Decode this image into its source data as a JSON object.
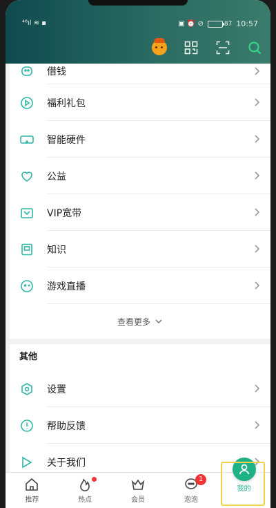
{
  "status_bar": {
    "signal": "⁴⁶ıl ≋ ▪",
    "icons": "▣ ⏰ ⊘",
    "battery": "87",
    "time": "10:57"
  },
  "menu": [
    {
      "label": "借钱",
      "icon": "piggy-bank-icon"
    },
    {
      "label": "福利礼包",
      "icon": "gift-play-icon"
    },
    {
      "label": "智能硬件",
      "icon": "vr-glasses-icon"
    },
    {
      "label": "公益",
      "icon": "heart-icon"
    },
    {
      "label": "VIP宽带",
      "icon": "broadband-icon"
    },
    {
      "label": "知识",
      "icon": "book-icon"
    },
    {
      "label": "游戏直播",
      "icon": "game-live-icon"
    }
  ],
  "see_more": "查看更多",
  "other": {
    "title": "其他",
    "items": [
      {
        "label": "设置",
        "icon": "settings-icon"
      },
      {
        "label": "帮助反馈",
        "icon": "help-icon"
      },
      {
        "label": "关于我们",
        "icon": "about-icon"
      }
    ]
  },
  "tabs": [
    {
      "label": "推荐",
      "icon": "home-icon"
    },
    {
      "label": "热点",
      "icon": "hot-flame-icon",
      "dot": true
    },
    {
      "label": "会员",
      "icon": "crown-icon"
    },
    {
      "label": "泡泡",
      "icon": "bubble-icon",
      "badge": "1"
    },
    {
      "label": "我的",
      "icon": "profile-icon",
      "active": true
    }
  ],
  "colors": {
    "accent": "#22b08a",
    "icon": "#2fb6a6",
    "header_start": "#0f4a4e",
    "header_end": "#3a7b6b"
  }
}
